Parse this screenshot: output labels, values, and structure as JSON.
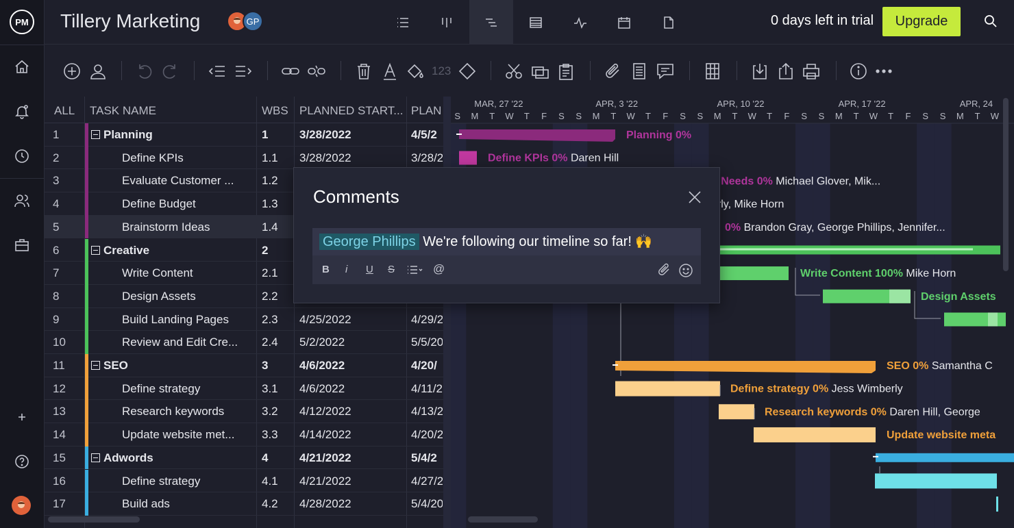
{
  "app": {
    "logo": "PM",
    "title": "Tillery Marketing",
    "avatar_initials": "GP",
    "trial_text": "0 days left in trial",
    "upgrade_label": "Upgrade"
  },
  "grid": {
    "headers": {
      "all": "ALL",
      "task_name": "TASK NAME",
      "wbs": "WBS",
      "planned_start": "PLANNED START...",
      "plan": "PLAN"
    },
    "rows": [
      {
        "num": "1",
        "name": "Planning",
        "wbs": "1",
        "start": "3/28/2022",
        "plan": "4/5/2",
        "parent": true,
        "color": "#8b2a7c"
      },
      {
        "num": "2",
        "name": "Define KPIs",
        "wbs": "1.1",
        "start": "3/28/2022",
        "plan": "3/28/2",
        "color": "#8b2a7c"
      },
      {
        "num": "3",
        "name": "Evaluate Customer ...",
        "wbs": "1.2",
        "start": "",
        "plan": "",
        "color": "#8b2a7c"
      },
      {
        "num": "4",
        "name": "Define Budget",
        "wbs": "1.3",
        "start": "",
        "plan": "",
        "color": "#8b2a7c"
      },
      {
        "num": "5",
        "name": "Brainstorm Ideas",
        "wbs": "1.4",
        "start": "",
        "plan": "",
        "color": "#8b2a7c"
      },
      {
        "num": "6",
        "name": "Creative",
        "wbs": "2",
        "start": "",
        "plan": "",
        "parent": true,
        "color": "#4cc25a"
      },
      {
        "num": "7",
        "name": "Write Content",
        "wbs": "2.1",
        "start": "",
        "plan": "",
        "color": "#4cc25a"
      },
      {
        "num": "8",
        "name": "Design Assets",
        "wbs": "2.2",
        "start": "",
        "plan": "",
        "color": "#4cc25a"
      },
      {
        "num": "9",
        "name": "Build Landing Pages",
        "wbs": "2.3",
        "start": "4/25/2022",
        "plan": "4/29/2",
        "color": "#4cc25a"
      },
      {
        "num": "10",
        "name": "Review and Edit Cre...",
        "wbs": "2.4",
        "start": "5/2/2022",
        "plan": "5/5/20",
        "color": "#4cc25a"
      },
      {
        "num": "11",
        "name": "SEO",
        "wbs": "3",
        "start": "4/6/2022",
        "plan": "4/20/",
        "parent": true,
        "color": "#f0a03a"
      },
      {
        "num": "12",
        "name": "Define strategy",
        "wbs": "3.1",
        "start": "4/6/2022",
        "plan": "4/11/2",
        "color": "#f0a03a"
      },
      {
        "num": "13",
        "name": "Research keywords",
        "wbs": "3.2",
        "start": "4/12/2022",
        "plan": "4/13/2",
        "color": "#f0a03a"
      },
      {
        "num": "14",
        "name": "Update website met...",
        "wbs": "3.3",
        "start": "4/14/2022",
        "plan": "4/20/2",
        "color": "#f0a03a"
      },
      {
        "num": "15",
        "name": "Adwords",
        "wbs": "4",
        "start": "4/21/2022",
        "plan": "5/4/2",
        "parent": true,
        "color": "#3aaee0"
      },
      {
        "num": "16",
        "name": "Define strategy",
        "wbs": "4.1",
        "start": "4/21/2022",
        "plan": "4/27/2",
        "color": "#3aaee0"
      },
      {
        "num": "17",
        "name": "Build ads",
        "wbs": "4.2",
        "start": "4/28/2022",
        "plan": "5/4/20",
        "color": "#3aaee0"
      }
    ]
  },
  "gantt": {
    "weeks": [
      "MAR, 27 '22",
      "APR, 3 '22",
      "APR, 10 '22",
      "APR, 17 '22",
      "APR, 24"
    ],
    "days": [
      "S",
      "M",
      "T",
      "W",
      "T",
      "F",
      "S",
      "S",
      "M",
      "T",
      "W",
      "T",
      "F",
      "S",
      "S",
      "M",
      "T",
      "W",
      "T",
      "F",
      "S",
      "S",
      "M",
      "T",
      "W",
      "T",
      "F",
      "S",
      "S",
      "M",
      "T",
      "W"
    ],
    "labels": [
      {
        "name": "Planning",
        "pct": "0%",
        "who": "",
        "color": "#b0359c"
      },
      {
        "name": "Define KPIs",
        "pct": "0%",
        "who": "Daren Hill",
        "color": "#b0359c"
      },
      {
        "name": "d Needs",
        "pct": "0%",
        "who": "Michael Glover, Mik...",
        "color": "#b0359c"
      },
      {
        "name": "",
        "pct": "",
        "who": "erly, Mike Horn",
        "color": "#b0359c"
      },
      {
        "name": "",
        "pct": "0%",
        "who": "Brandon Gray, George Phillips, Jennifer...",
        "color": "#b0359c"
      },
      {
        "name": "Write Content",
        "pct": "100%",
        "who": "Mike Horn",
        "color": "#5fd06c"
      },
      {
        "name": "Design Assets",
        "pct": "",
        "who": "",
        "color": "#5fd06c"
      },
      {
        "name": "SEO",
        "pct": "0%",
        "who": "Samantha C",
        "color": "#f0a03a"
      },
      {
        "name": "Define strategy",
        "pct": "0%",
        "who": "Jess Wimberly",
        "color": "#f0a03a"
      },
      {
        "name": "Research keywords",
        "pct": "0%",
        "who": "Daren Hill, George",
        "color": "#f0a03a"
      },
      {
        "name": "Update website meta",
        "pct": "",
        "who": "",
        "color": "#f0a03a"
      }
    ]
  },
  "comments": {
    "title": "Comments",
    "mention": "George Phillips",
    "text": "We're following our timeline so far! 🙌",
    "format": {
      "bold": "B",
      "italic": "i",
      "underline": "U",
      "strike": "S",
      "at": "@"
    }
  },
  "toolbar": {
    "number_label": "123"
  }
}
